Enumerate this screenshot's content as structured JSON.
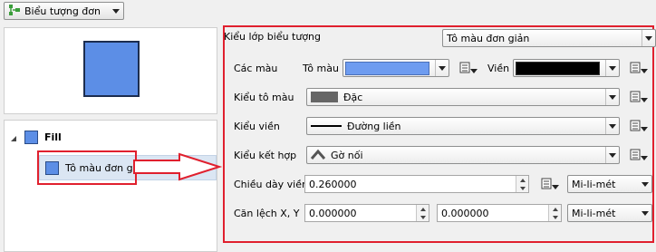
{
  "toolbar": {
    "symbol_type_label": "Biểu tượng đơn"
  },
  "colors": {
    "fill": "#5c8ee6",
    "stroke": "#000000",
    "accent_red": "#e0202e"
  },
  "tree": {
    "root_label": "Fill",
    "child_label": "Tô màu đơn giản"
  },
  "panel": {
    "symbol_layer_type_label": "Kiểu lớp biểu tượng",
    "symbol_layer_type_value": "Tô màu đơn giản",
    "colors_label": "Các màu",
    "fill_color_label": "Tô màu",
    "stroke_color_label": "Viền",
    "fill_style_label": "Kiểu tô màu",
    "fill_style_value": "Đặc",
    "stroke_style_label": "Kiểu viền",
    "stroke_style_value": "Đường liền",
    "join_style_label": "Kiểu kết hợp",
    "join_style_value": "Gờ nối",
    "stroke_width_label": "Chiều dày viền",
    "stroke_width_value": "0.260000",
    "stroke_width_unit": "Mi-li-mét",
    "offset_label": "Căn lệch X, Y",
    "offset_x_value": "0.000000",
    "offset_y_value": "0.000000",
    "offset_unit": "Mi-li-mét"
  }
}
